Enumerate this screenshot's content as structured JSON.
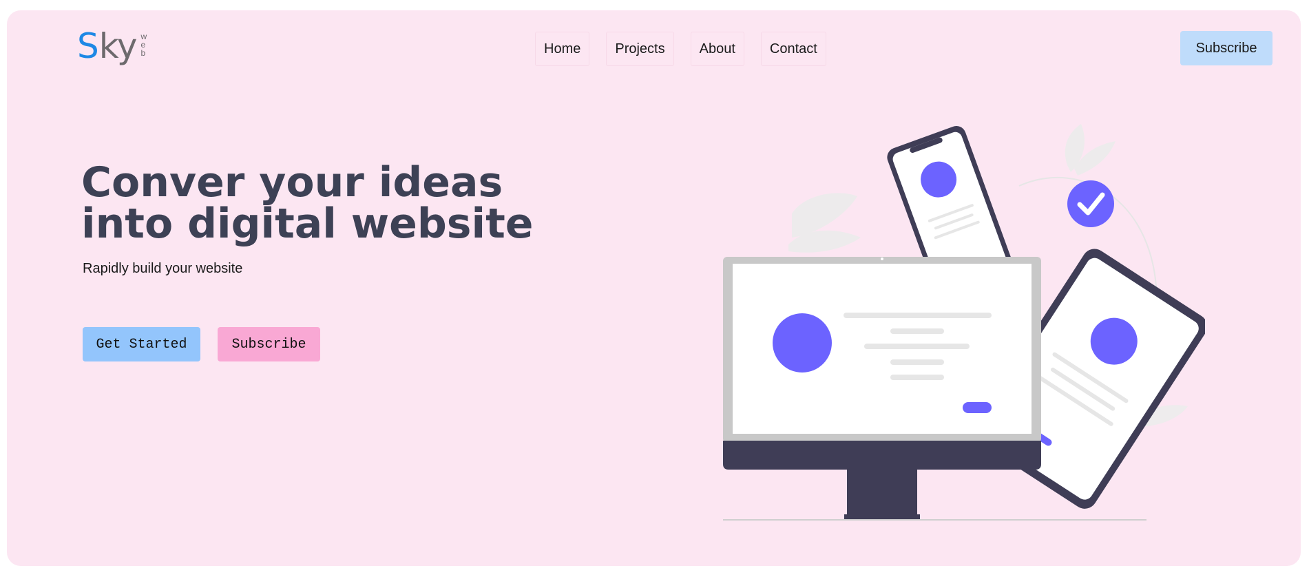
{
  "logo": {
    "s": "S",
    "ky": "ky",
    "web": [
      "w",
      "e",
      "b"
    ]
  },
  "nav": {
    "items": [
      "Home",
      "Projects",
      "About",
      "Contact"
    ]
  },
  "header": {
    "subscribe_label": "Subscribe"
  },
  "hero": {
    "title": "Conver your ideas into digital website",
    "subtitle": "Rapidly build your website",
    "get_started_label": "Get Started",
    "subscribe_label": "Subscribe"
  },
  "colors": {
    "page_bg": "#fce6f2",
    "accent_blue": "#93c5fc",
    "accent_pink": "#f9a8d4",
    "illustration_purple": "#6c63ff",
    "illustration_dark": "#3f3d56"
  },
  "illustration": {
    "name": "responsive-devices-illustration"
  }
}
